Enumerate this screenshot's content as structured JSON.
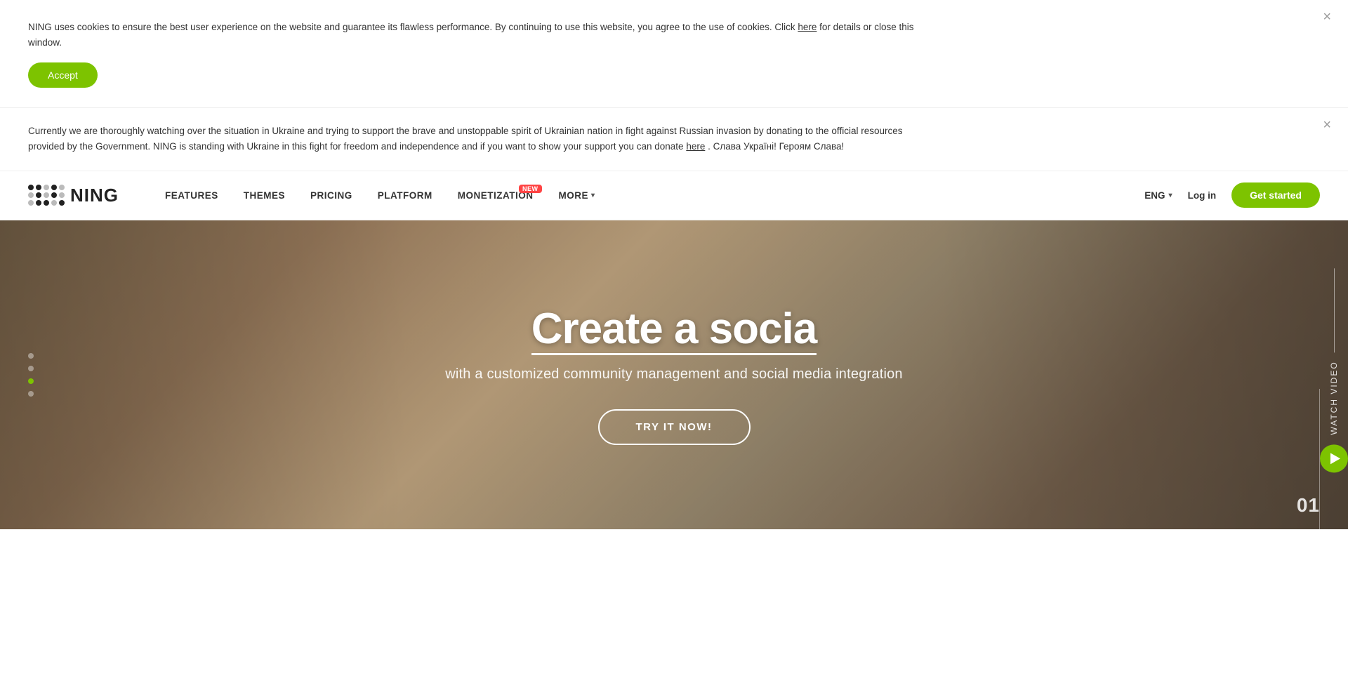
{
  "cookie_banner": {
    "text": "NING uses cookies to ensure the best user experience on the website and guarantee its flawless performance. By continuing to use this website, you agree to the use of cookies. Click",
    "link_text": "here",
    "text_after": "for details or close this window.",
    "accept_label": "Accept",
    "close_icon": "×"
  },
  "ukraine_banner": {
    "text_start": "Currently we are thoroughly watching over the situation in Ukraine and trying to support the brave and unstoppable spirit of Ukrainian nation in fight against Russian invasion by donating to the official resources provided by the Government. NING is standing with Ukraine in this fight for freedom and independence and if you want to show your support you can donate",
    "link_text": "here",
    "text_end": ". Слава Україні! Героям Слава!",
    "close_icon": "×"
  },
  "navbar": {
    "logo_text": "NING",
    "nav_items": [
      {
        "label": "FEATURES",
        "id": "features",
        "badge": null
      },
      {
        "label": "THEMES",
        "id": "themes",
        "badge": null
      },
      {
        "label": "PRICING",
        "id": "pricing",
        "badge": null
      },
      {
        "label": "PLATFORM",
        "id": "platform",
        "badge": null
      },
      {
        "label": "MONETIZATION",
        "id": "monetization",
        "badge": "NEW"
      },
      {
        "label": "MORE",
        "id": "more",
        "badge": null,
        "has_arrow": true
      }
    ],
    "lang": "ENG",
    "login_label": "Log in",
    "get_started_label": "Get started"
  },
  "hero": {
    "title_text": "Create a socia",
    "subtitle": "with a customized community management and social media integration",
    "cta_label": "TRY IT NOW!",
    "slide_number": "01",
    "watch_video_label": "Watch video",
    "slide_indicators": [
      {
        "active": false
      },
      {
        "active": false
      },
      {
        "active": true
      },
      {
        "active": false
      }
    ]
  }
}
